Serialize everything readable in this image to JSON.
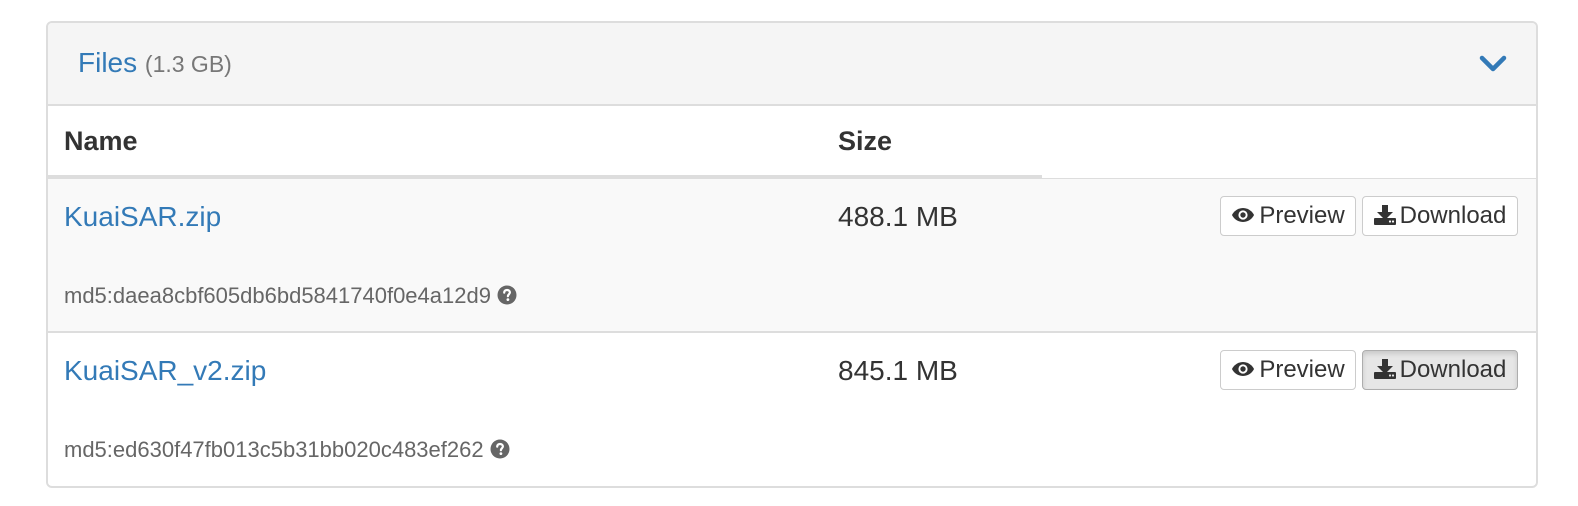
{
  "panel": {
    "title": "Files",
    "total_size": "(1.3 GB)",
    "toggle_icon": "chevron-down-icon",
    "accent_color": "#337ab7"
  },
  "table": {
    "columns": [
      "Name",
      "Size"
    ],
    "rows": [
      {
        "name": "KuaiSAR.zip",
        "size": "488.1 MB",
        "checksum": "md5:daea8cbf605db6bd5841740f0e4a12d9",
        "preview_label": "Preview",
        "download_label": "Download",
        "download_active": false
      },
      {
        "name": "KuaiSAR_v2.zip",
        "size": "845.1 MB",
        "checksum": "md5:ed630f47fb013c5b31bb020c483ef262",
        "preview_label": "Preview",
        "download_label": "Download",
        "download_active": true
      }
    ]
  },
  "icons": {
    "preview": "eye-icon",
    "download": "download-icon",
    "help": "question-circle-icon"
  }
}
